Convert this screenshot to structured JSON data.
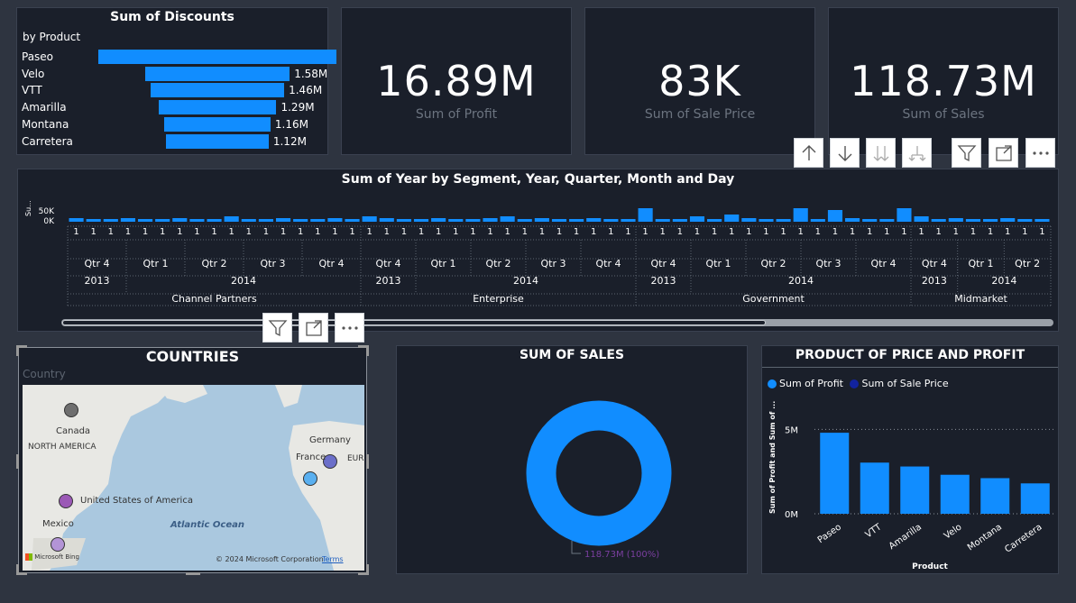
{
  "discounts": {
    "title": "Sum of Discounts",
    "subtitle": "by Product",
    "items": [
      {
        "label": "Paseo",
        "value": 2.6,
        "display": ""
      },
      {
        "label": "Velo",
        "value": 1.58,
        "display": "1.58M"
      },
      {
        "label": "VTT",
        "value": 1.46,
        "display": "1.46M"
      },
      {
        "label": "Amarilla",
        "value": 1.29,
        "display": "1.29M"
      },
      {
        "label": "Montana",
        "value": 1.16,
        "display": "1.16M"
      },
      {
        "label": "Carretera",
        "value": 1.12,
        "display": "1.12M"
      }
    ]
  },
  "kpis": [
    {
      "value": "16.89M",
      "label": "Sum of Profit"
    },
    {
      "value": "83K",
      "label": "Sum of Sale Price"
    },
    {
      "value": "118.73M",
      "label": "Sum of  Sales"
    }
  ],
  "toolbar_icons": [
    "drill-up-icon",
    "drill-down-icon",
    "expand-all-icon",
    "expand-next-icon",
    "filter-icon",
    "focus-mode-icon",
    "more-options-icon"
  ],
  "timeline": {
    "title": "Sum of Year by Segment, Year, Quarter, Month and Day",
    "y_label": "Su...",
    "y_ticks": [
      "50K",
      "0K"
    ],
    "row_day": "1",
    "segments": [
      {
        "name": "Channel Partners",
        "years": [
          {
            "year": "2013",
            "quarters": [
              "Qtr 4"
            ]
          },
          {
            "year": "2014",
            "quarters": [
              "Qtr 1",
              "Qtr 2",
              "Qtr 3",
              "Qtr 4"
            ]
          }
        ]
      },
      {
        "name": "Enterprise",
        "years": [
          {
            "year": "2013",
            "quarters": [
              "Qtr 4"
            ]
          },
          {
            "year": "2014",
            "quarters": [
              "Qtr 1",
              "Qtr 2",
              "Qtr 3",
              "Qtr 4"
            ]
          }
        ]
      },
      {
        "name": "Government",
        "years": [
          {
            "year": "2013",
            "quarters": [
              "Qtr 4"
            ]
          },
          {
            "year": "2014",
            "quarters": [
              "Qtr 1",
              "Qtr 2",
              "Qtr 3",
              "Qtr 4"
            ]
          }
        ]
      },
      {
        "name": "Midmarket",
        "years": [
          {
            "year": "2013",
            "quarters": [
              "Qtr 4"
            ]
          },
          {
            "year": "2014",
            "quarters": [
              "Qtr 1",
              "Qtr 2"
            ]
          }
        ]
      }
    ]
  },
  "countries": {
    "title": "COUNTRIES",
    "field": "Country",
    "map_labels": {
      "north_america": "NORTH AMERICA",
      "ocean": "Atlantic Ocean",
      "europe": "EUR"
    },
    "points": [
      {
        "name": "Canada",
        "color": "#6e6e6e"
      },
      {
        "name": "United States of America",
        "color": "#9b59b6"
      },
      {
        "name": "Mexico",
        "color": "#b394d6"
      },
      {
        "name": "Germany",
        "color": "#6b6fc9"
      },
      {
        "name": "France",
        "color": "#5ab0f0"
      }
    ],
    "copyright": "© 2024 Microsoft Corporation",
    "terms": "Terms",
    "bing": "Microsoft Bing"
  },
  "sales": {
    "title": "SUM OF SALES",
    "label": "118.73M (100%)"
  },
  "chart_data": {
    "type": "bar",
    "title": "PRODUCT OF PRICE AND PROFIT",
    "categories": [
      "Paseo",
      "VTT",
      "Amarilla",
      "Velo",
      "Montana",
      "Carretera"
    ],
    "series": [
      {
        "name": "Sum of Profit",
        "values": [
          4.8,
          3.03,
          2.8,
          2.31,
          2.11,
          1.8
        ],
        "color": "#118dff"
      },
      {
        "name": "Sum of Sale Price",
        "values": [
          0.02,
          0.01,
          0.01,
          0.01,
          0.01,
          0.01
        ],
        "color": "#12239e"
      }
    ],
    "xlabel": "Product",
    "ylabel": "Sum of Profit and Sum of ...",
    "y_ticks": [
      "5M",
      "0M"
    ],
    "ylim": [
      0,
      6.3
    ]
  }
}
